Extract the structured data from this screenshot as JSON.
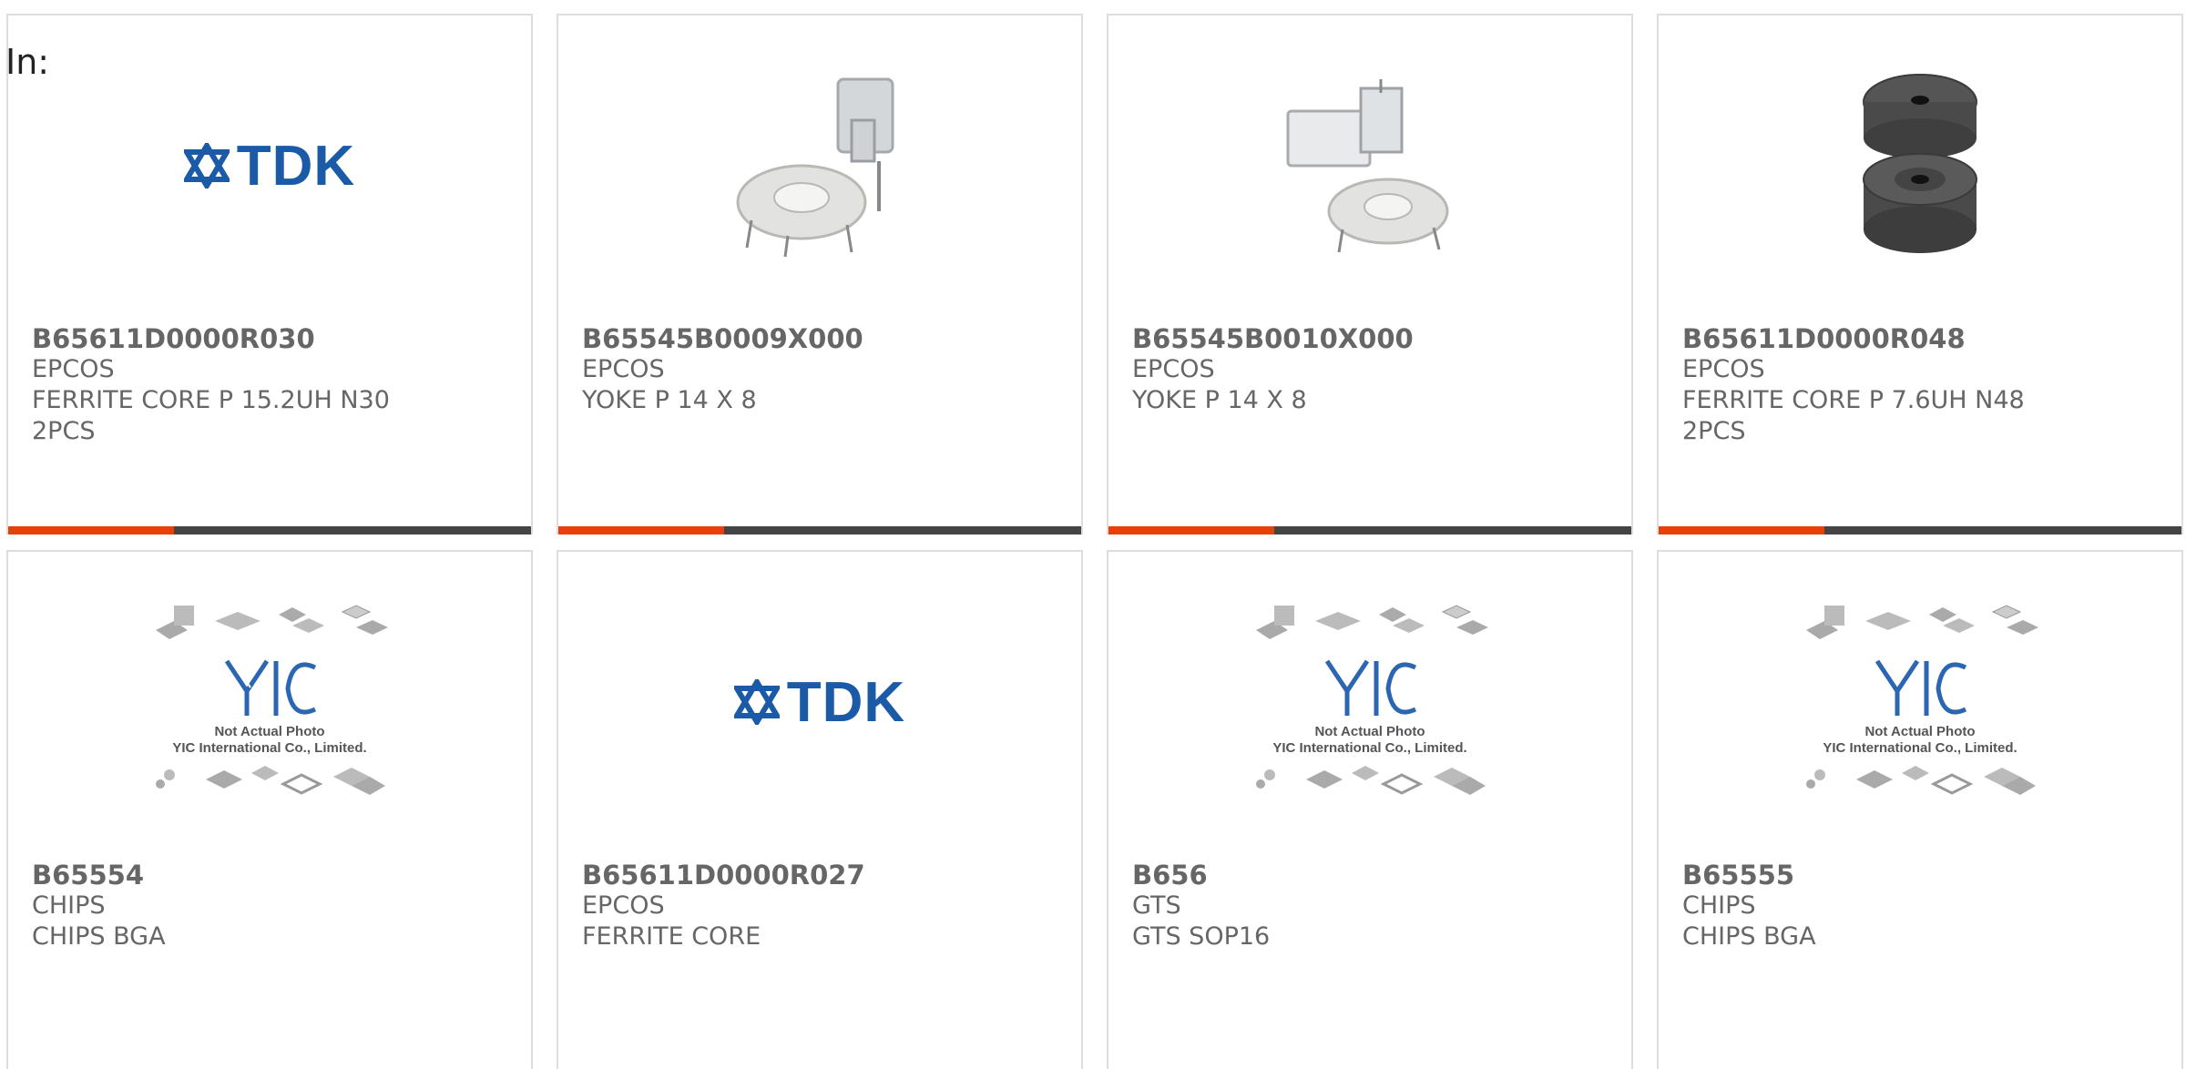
{
  "header": {
    "in_label": "In:"
  },
  "accent_color": "#e8400c",
  "bar_color": "#444444",
  "brand_color": "#1a5aa6",
  "products": [
    {
      "part": "B65611D0000R030",
      "maker": "EPCOS",
      "desc": "FERRITE CORE P 15.2UH N30",
      "extra": "2PCS",
      "image": "tdk-logo"
    },
    {
      "part": "B65545B0009X000",
      "maker": "EPCOS",
      "desc": "YOKE P 14 X 8",
      "extra": "",
      "image": "yoke-photo"
    },
    {
      "part": "B65545B0010X000",
      "maker": "EPCOS",
      "desc": "YOKE P 14 X 8",
      "extra": "",
      "image": "yoke-photo"
    },
    {
      "part": "B65611D0000R048",
      "maker": "EPCOS",
      "desc": "FERRITE CORE P 7.6UH N48",
      "extra": "2PCS",
      "image": "ferrite-core-photo"
    },
    {
      "part": "B65554",
      "maker": "CHIPS",
      "desc": "CHIPS BGA",
      "extra": "",
      "image": "yic-placeholder"
    },
    {
      "part": "B65611D0000R027",
      "maker": "EPCOS",
      "desc": "FERRITE CORE",
      "extra": "",
      "image": "tdk-logo"
    },
    {
      "part": "B656",
      "maker": "GTS",
      "desc": "GTS SOP16",
      "extra": "",
      "image": "yic-placeholder"
    },
    {
      "part": "B65555",
      "maker": "CHIPS",
      "desc": "CHIPS BGA",
      "extra": "",
      "image": "yic-placeholder"
    }
  ],
  "tdk_logo": {
    "text": "TDK"
  },
  "yic_placeholder": {
    "line1": "Not Actual Photo",
    "line2": "YIC International Co., Limited.",
    "logo_text": "YIC"
  }
}
